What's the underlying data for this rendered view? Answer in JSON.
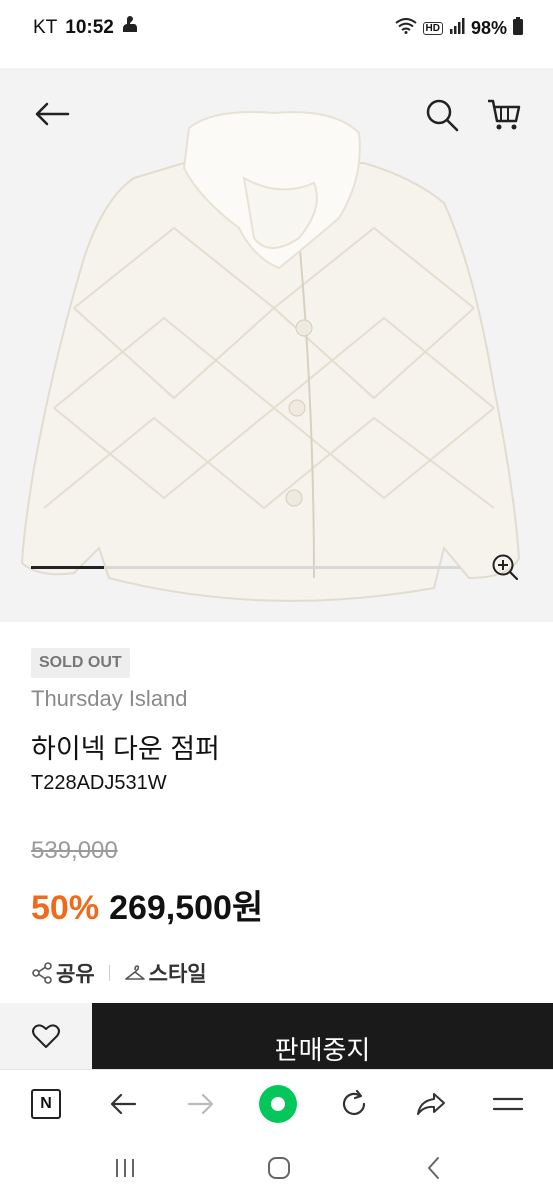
{
  "status_bar": {
    "carrier": "KT",
    "time": "10:52",
    "hd": "HD",
    "battery": "98%"
  },
  "gallery": {
    "slide_progress": 0.17
  },
  "product": {
    "badge": "SOLD OUT",
    "brand": "Thursday Island",
    "title": "하이넥 다운 점퍼",
    "model": "T228ADJ531W",
    "original_price": "539,000",
    "discount": "50%",
    "sale_price": "269,500원"
  },
  "actions": {
    "share": "공유",
    "style": "스타일"
  },
  "buy_bar": {
    "status_label": "판매중지"
  },
  "browser_toolbar": {
    "home_letter": "N",
    "accent": "#03c75a"
  },
  "colors": {
    "discount": "#f06a1d",
    "dark_button": "#1a1a1a"
  }
}
